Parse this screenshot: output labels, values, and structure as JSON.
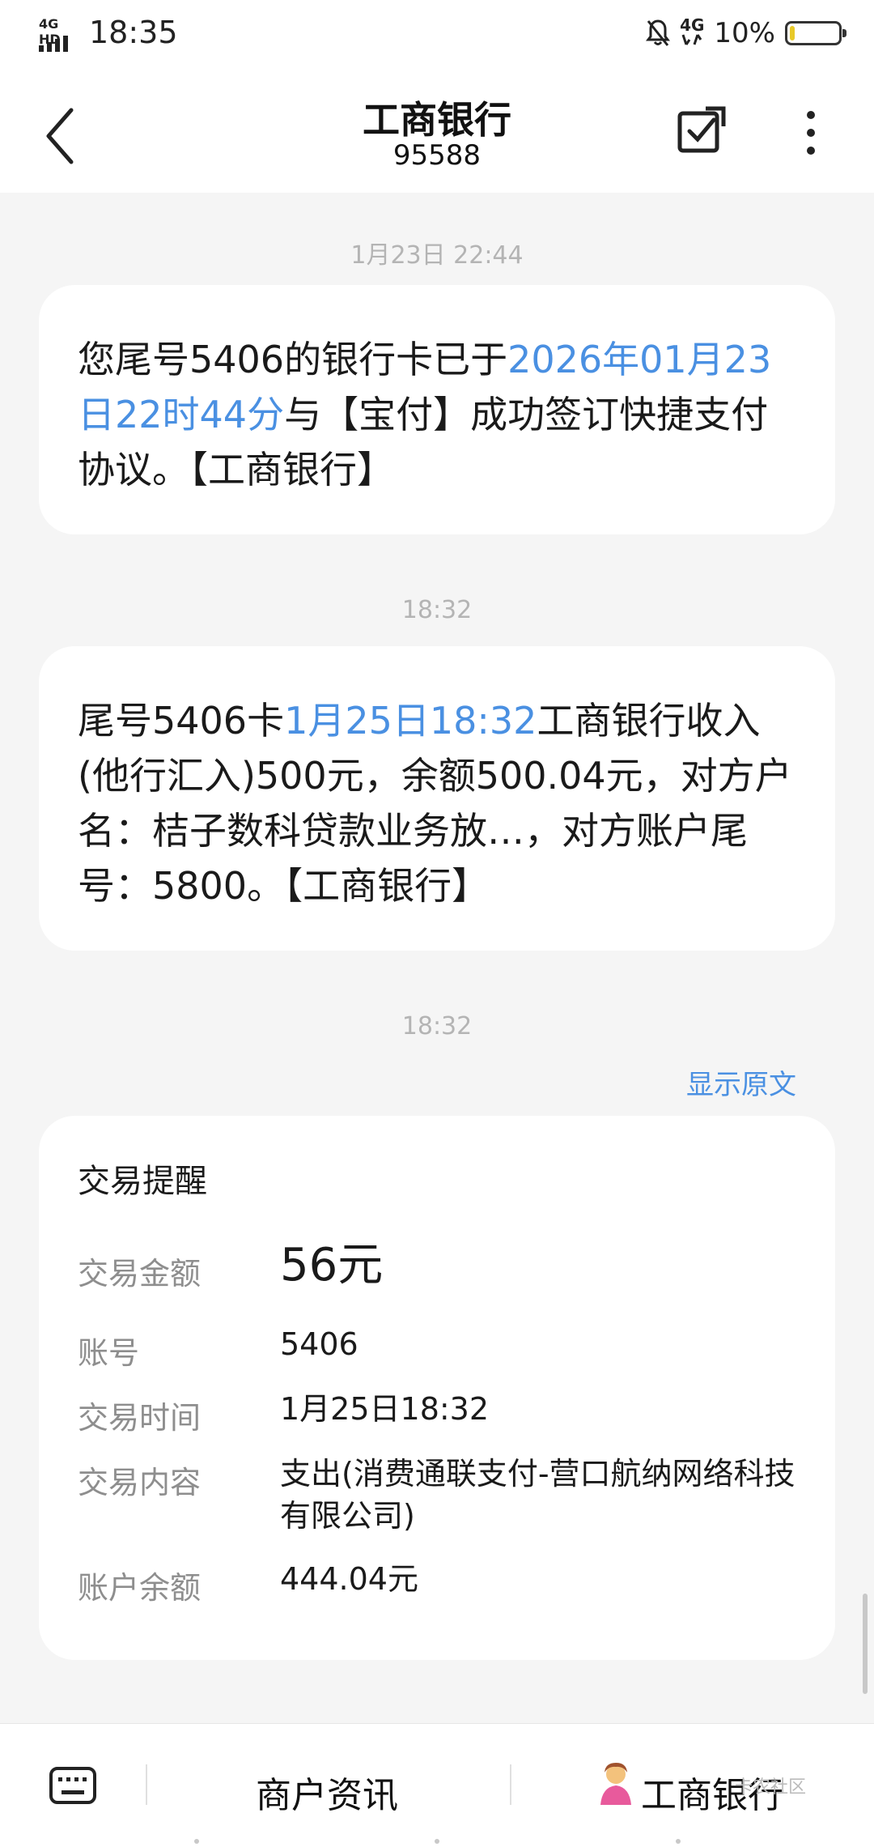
{
  "status_bar": {
    "network_label": "4G HD",
    "time": "18:35",
    "right_network": "4G",
    "battery_percent_text": "10%",
    "battery_level": 0.1,
    "battery_color": "#e8c928"
  },
  "header": {
    "title": "工商银行",
    "number": "95588"
  },
  "messages": [
    {
      "timestamp": "1月23日 22:44",
      "parts": [
        {
          "text": "您尾号5406的银行卡已于",
          "highlight": false
        },
        {
          "text": "2026年01月23日22时44分",
          "highlight": true
        },
        {
          "text": "与【宝付】成功签订快捷支付协议。【工商银行】",
          "highlight": false
        }
      ]
    },
    {
      "timestamp": "18:32",
      "parts": [
        {
          "text": "尾号5406卡",
          "highlight": false
        },
        {
          "text": "1月25日18:32",
          "highlight": true
        },
        {
          "text": "工商银行收入(他行汇入)500元，余额500.04元，对方户名：桔子数科贷款业务放…，对方账户尾号：5800。【工商银行】",
          "highlight": false
        }
      ]
    }
  ],
  "card_message": {
    "timestamp": "18:32",
    "show_original": "显示原文",
    "title": "交易提醒",
    "rows": [
      {
        "label": "交易金额",
        "value": "56元"
      },
      {
        "label": "账号",
        "value": "5406"
      },
      {
        "label": "交易时间",
        "value": "1月25日18:32"
      },
      {
        "label": "交易内容",
        "value": "支出(消费通联支付-营口航纳网络科技有限公司)"
      },
      {
        "label": "账户余额",
        "value": "444.04元"
      }
    ]
  },
  "bottom_bar": {
    "menu_1": "商户资讯",
    "menu_2": "工商银行",
    "watermark": "卡农社区"
  },
  "colors": {
    "accent_blue": "#4a90e2",
    "timestamp_gray": "#b4b4b4",
    "background": "#f5f5f5"
  },
  "icons": [
    "back-arrow-icon",
    "select-checkbox-icon",
    "more-vertical-icon",
    "keyboard-icon",
    "person-emoji-icon"
  ]
}
